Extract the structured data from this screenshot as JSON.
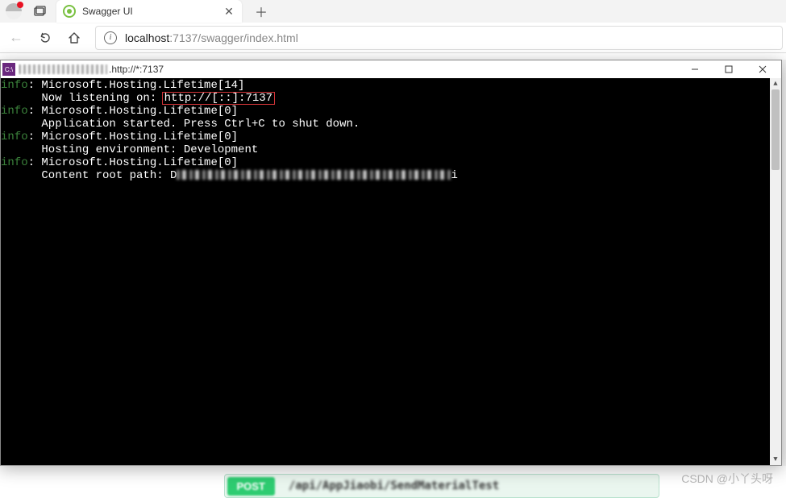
{
  "browser": {
    "tab": {
      "title": "Swagger UI"
    },
    "url": {
      "host": "localhost",
      "rest": ":7137/swagger/index.html"
    }
  },
  "terminal": {
    "title_suffix": ".http://*:7137",
    "icon_text": "C:\\",
    "lines": [
      {
        "prefix": "info",
        "text": ": Microsoft.Hosting.Lifetime[14]"
      },
      {
        "prefix": "",
        "text": "      Now listening on: ",
        "highlight": "http://[::]:7137"
      },
      {
        "prefix": "info",
        "text": ": Microsoft.Hosting.Lifetime[0]"
      },
      {
        "prefix": "",
        "text": "      Application started. Press Ctrl+C to shut down."
      },
      {
        "prefix": "info",
        "text": ": Microsoft.Hosting.Lifetime[0]"
      },
      {
        "prefix": "",
        "text": "      Hosting environment: Development"
      },
      {
        "prefix": "info",
        "text": ": Microsoft.Hosting.Lifetime[0]"
      },
      {
        "prefix": "",
        "text": "      Content root path: D",
        "tail_pixelated": true,
        "tail_char": "i"
      }
    ]
  },
  "swagger": {
    "method": "POST",
    "path": "/api/AppJiaobi/SendMaterialTest"
  },
  "watermark": "CSDN @小丫头呀"
}
